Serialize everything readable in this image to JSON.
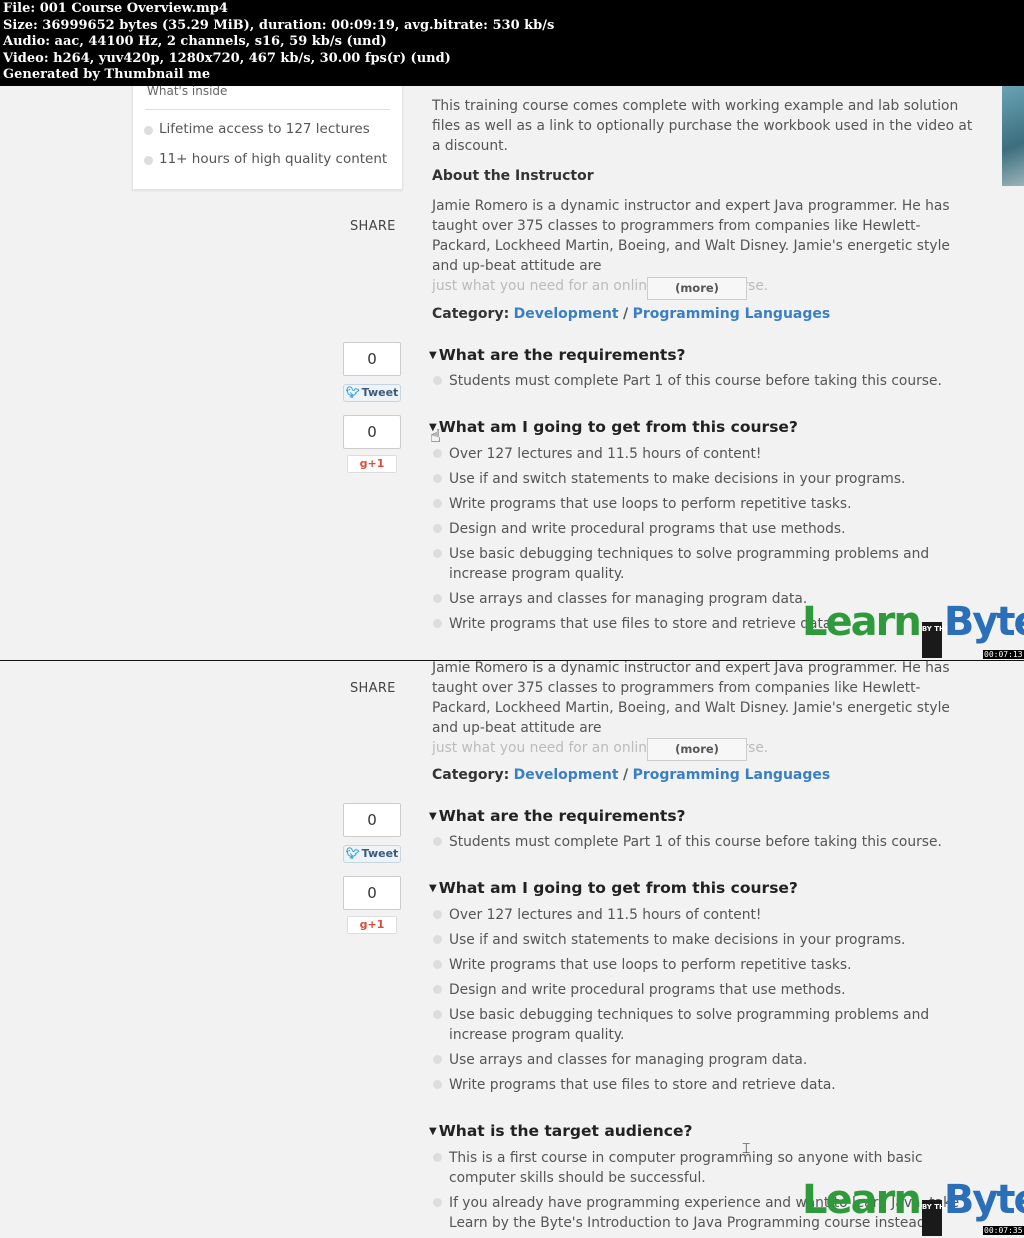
{
  "video_info": {
    "file": "File: 001 Course Overview.mp4",
    "size": "Size: 36999652 bytes (35.29 MiB), duration: 00:09:19, avg.bitrate: 530 kb/s",
    "audio": "Audio: aac, 44100 Hz, 2 channels, s16, 59 kb/s (und)",
    "video": "Video: h264, yuv420p, 1280x720, 467 kb/s, 30.00 fps(r) (und)",
    "generator": "Generated by Thumbnail me"
  },
  "sidebar": {
    "heading": "What's inside",
    "bullets": [
      "Lifetime access to 127 lectures",
      "11+ hours of high quality content"
    ]
  },
  "share_label": "SHARE",
  "description": {
    "intro": "This training course comes complete with working example and lab solution files as well as a link to optionally purchase the workbook used in the video at a discount.",
    "about_heading": "About the Instructor",
    "about_text": "Jamie Romero is a dynamic instructor and expert Java programmer. He has taught over 375 classes to programmers from companies like Hewlett-Packard, Lockheed Martin, Boeing, and Walt Disney. Jamie's energetic style and up-beat attitude are",
    "about_fade": "just what you need for an online training course.",
    "more_button": "(more)"
  },
  "category": {
    "label": "Category:",
    "primary": "Development",
    "separator": "/",
    "secondary": "Programming Languages"
  },
  "social": {
    "tweet_count": "0",
    "tweet_label": "Tweet",
    "gplus_count": "0",
    "gplus_label": "+1"
  },
  "requirements": {
    "heading": "What are the requirements?",
    "items": [
      "Students must complete Part 1 of this course before taking this course."
    ]
  },
  "outcomes": {
    "heading": "What am I going to get from this course?",
    "items": [
      "Over 127 lectures and 11.5 hours of content!",
      "Use if and switch statements to make decisions in your programs.",
      "Write programs that use loops to perform repetitive tasks.",
      "Design and write procedural programs that use methods.",
      "Use basic debugging techniques to solve programming problems and increase program quality.",
      "Use arrays and classes for managing program data.",
      "Write programs that use files to store and retrieve data."
    ]
  },
  "audience": {
    "heading": "What is the target audience?",
    "items": [
      "This is a first course in computer programming so anyone with basic computer skills should be successful.",
      "If you already have programming experience and want to learn Java, take Learn by the Byte's Introduction to Java Programming course instead."
    ]
  },
  "logo": {
    "learn": "Learn",
    "by": "BY THE",
    "byte": "Byte"
  },
  "timestamps": [
    "00:07:13",
    "00:07:35"
  ]
}
